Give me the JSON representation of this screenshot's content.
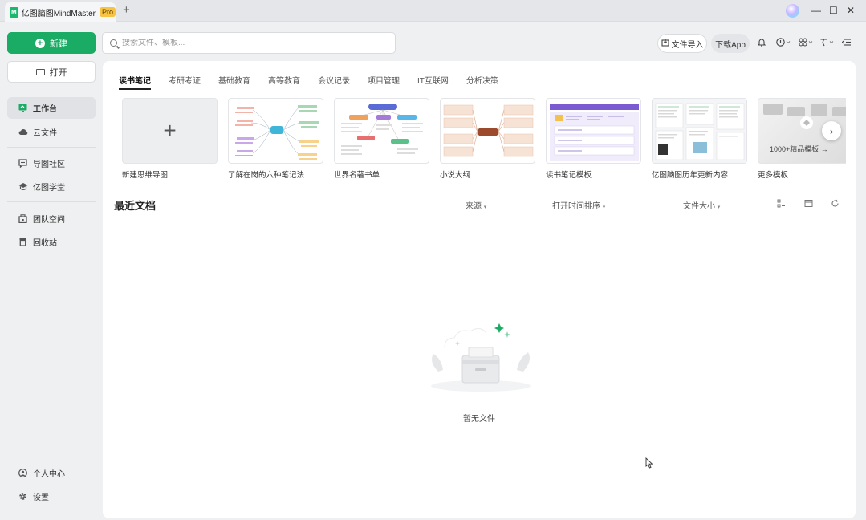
{
  "window": {
    "tab_title": "亿图脑图MindMaster",
    "badge": "Pro",
    "new_tab": "+",
    "minimize": "—",
    "maximize": "☐",
    "close": "✕"
  },
  "sidebar": {
    "new_label": "新建",
    "open_label": "打开",
    "items": [
      {
        "label": "工作台",
        "icon": "workbench-icon"
      },
      {
        "label": "云文件",
        "icon": "cloud-icon"
      },
      {
        "label": "导图社区",
        "icon": "community-icon"
      },
      {
        "label": "亿图学堂",
        "icon": "academy-icon"
      },
      {
        "label": "团队空间",
        "icon": "team-space-icon"
      },
      {
        "label": "回收站",
        "icon": "trash-icon"
      }
    ],
    "bottom": [
      {
        "label": "个人中心",
        "icon": "user-icon"
      },
      {
        "label": "设置",
        "icon": "gear-icon"
      }
    ]
  },
  "search": {
    "placeholder": "搜索文件、模板..."
  },
  "toolbar": {
    "import_label": "文件导入",
    "download_label": "下载App"
  },
  "categories": [
    "读书笔记",
    "考研考证",
    "基础教育",
    "高等教育",
    "会议记录",
    "项目管理",
    "IT互联网",
    "分析决策"
  ],
  "templates": [
    {
      "label": "新建思维导图",
      "kind": "blank"
    },
    {
      "label": "了解在岗的六种笔记法",
      "kind": "mindmap-green"
    },
    {
      "label": "世界名著书单",
      "kind": "mindmap-orange"
    },
    {
      "label": "小说大纲",
      "kind": "mindmap-brown"
    },
    {
      "label": "读书笔记模板",
      "kind": "mindmap-purple"
    },
    {
      "label": "亿图脑图历年更新内容",
      "kind": "mindmap-grey"
    },
    {
      "label": "更多模板",
      "kind": "more",
      "overlay": "1000+精品模板"
    }
  ],
  "recent": {
    "title": "最近文档",
    "filter_source": "来源",
    "filter_sort": "打开时间排序",
    "filter_size": "文件大小",
    "empty_text": "暂无文件"
  },
  "colors": {
    "accent": "#1aab64",
    "panel": "#ffffff",
    "background": "#eef0f2"
  }
}
